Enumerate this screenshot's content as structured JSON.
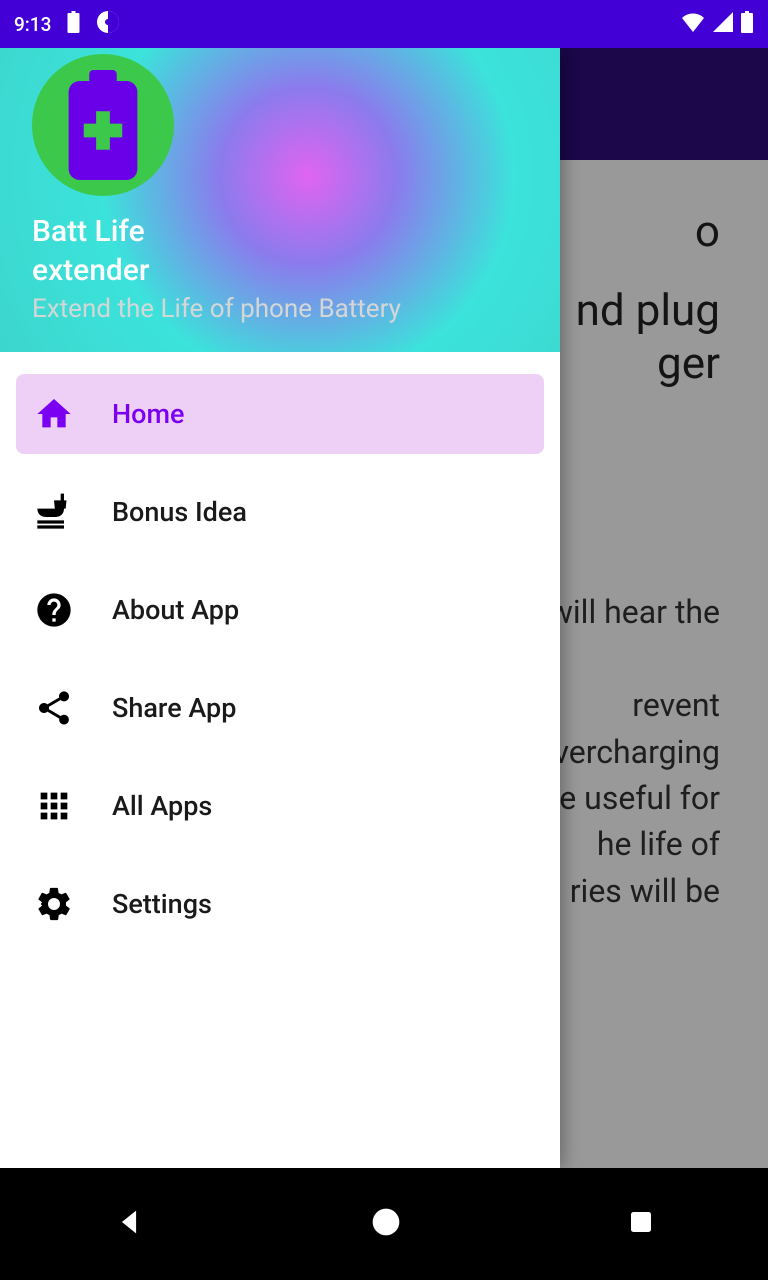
{
  "status": {
    "time": "9:13"
  },
  "drawer": {
    "title": "Batt Life\nextender",
    "subtitle": "Extend the Life of phone Battery",
    "items": [
      {
        "label": "Home"
      },
      {
        "label": "Bonus Idea"
      },
      {
        "label": "About App"
      },
      {
        "label": "Share App"
      },
      {
        "label": "All Apps"
      },
      {
        "label": "Settings"
      }
    ]
  },
  "main": {
    "line1": "o",
    "line2": "nd plug ger",
    "para": "will hear the\n\nrevent vercharging e useful for he life of ries will be"
  }
}
